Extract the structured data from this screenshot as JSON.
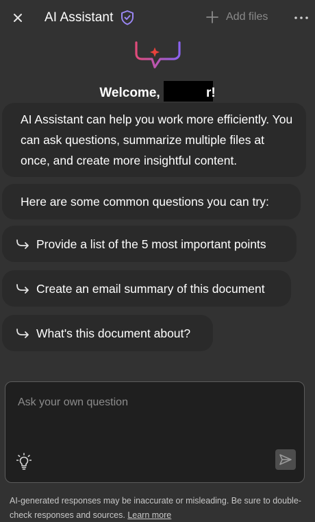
{
  "header": {
    "title": "AI Assistant",
    "add_files_label": "Add files",
    "icons": [
      "close-icon",
      "shield-check-icon",
      "plus-icon",
      "more-horizontal-icon"
    ]
  },
  "welcome": {
    "prefix": "Welcome,",
    "name_redacted": true,
    "suffix": "r!"
  },
  "intro_text": "AI Assistant can help you work more efficiently. You can ask questions, summarize multiple files at once, and create more insightful content.",
  "suggestions_heading": "Here are some common questions you can try:",
  "suggestions": [
    "Provide a list of the 5 most important points",
    "Create an email summary of this document",
    "What's this document about?"
  ],
  "input": {
    "placeholder": "Ask your own question",
    "value": ""
  },
  "disclaimer": {
    "text": "AI-generated responses may be inaccurate or misleading. Be sure to double-check responses and sources.",
    "link_label": "Learn more"
  },
  "colors": {
    "background": "#323232",
    "bubble": "#2a2a2a",
    "input_background": "#1f1f1f",
    "accent_purple": "#a78bfa",
    "accent_red": "#e8423c"
  }
}
